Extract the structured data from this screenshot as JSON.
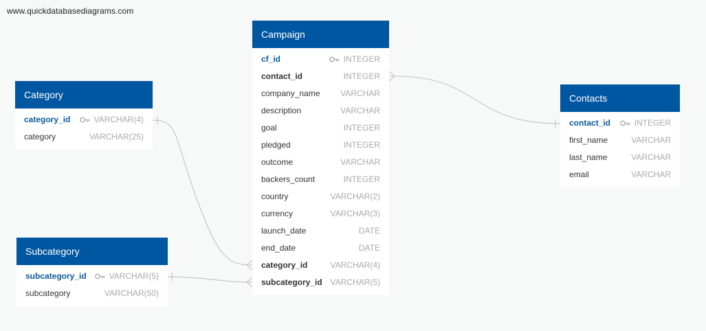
{
  "watermark": "www.quickdatabasediagrams.com",
  "colors": {
    "header": "#0057a1",
    "pk_text": "#0c5b9e",
    "type_text": "#a9a9a9",
    "link": "#c7c7c7"
  },
  "tables": {
    "campaign": {
      "title": "Campaign",
      "columns": [
        {
          "name": "cf_id",
          "type": "INTEGER",
          "key": "pk"
        },
        {
          "name": "contact_id",
          "type": "INTEGER",
          "key": "fk"
        },
        {
          "name": "company_name",
          "type": "VARCHAR",
          "key": ""
        },
        {
          "name": "description",
          "type": "VARCHAR",
          "key": ""
        },
        {
          "name": "goal",
          "type": "INTEGER",
          "key": ""
        },
        {
          "name": "pledged",
          "type": "INTEGER",
          "key": ""
        },
        {
          "name": "outcome",
          "type": "VARCHAR",
          "key": ""
        },
        {
          "name": "backers_count",
          "type": "INTEGER",
          "key": ""
        },
        {
          "name": "country",
          "type": "VARCHAR(2)",
          "key": ""
        },
        {
          "name": "currency",
          "type": "VARCHAR(3)",
          "key": ""
        },
        {
          "name": "launch_date",
          "type": "DATE",
          "key": ""
        },
        {
          "name": "end_date",
          "type": "DATE",
          "key": ""
        },
        {
          "name": "category_id",
          "type": "VARCHAR(4)",
          "key": "fk"
        },
        {
          "name": "subcategory_id",
          "type": "VARCHAR(5)",
          "key": "fk"
        }
      ]
    },
    "category": {
      "title": "Category",
      "columns": [
        {
          "name": "category_id",
          "type": "VARCHAR(4)",
          "key": "pk"
        },
        {
          "name": "category",
          "type": "VARCHAR(25)",
          "key": ""
        }
      ]
    },
    "subcategory": {
      "title": "Subcategory",
      "columns": [
        {
          "name": "subcategory_id",
          "type": "VARCHAR(5)",
          "key": "pk"
        },
        {
          "name": "subcategory",
          "type": "VARCHAR(50)",
          "key": ""
        }
      ]
    },
    "contacts": {
      "title": "Contacts",
      "columns": [
        {
          "name": "contact_id",
          "type": "INTEGER",
          "key": "pk"
        },
        {
          "name": "first_name",
          "type": "VARCHAR",
          "key": ""
        },
        {
          "name": "last_name",
          "type": "VARCHAR",
          "key": ""
        },
        {
          "name": "email",
          "type": "VARCHAR",
          "key": ""
        }
      ]
    }
  },
  "relationships": [
    {
      "from": "category.category_id",
      "to": "campaign.category_id",
      "cardinality": "one-to-many"
    },
    {
      "from": "subcategory.subcategory_id",
      "to": "campaign.subcategory_id",
      "cardinality": "one-to-many"
    },
    {
      "from": "contacts.contact_id",
      "to": "campaign.contact_id",
      "cardinality": "one-to-many"
    }
  ]
}
